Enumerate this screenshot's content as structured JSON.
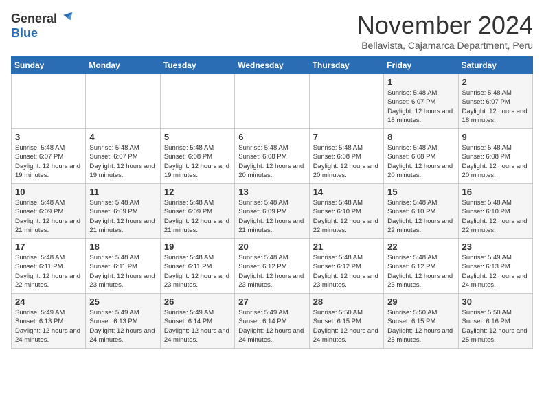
{
  "header": {
    "logo_general": "General",
    "logo_blue": "Blue",
    "month_title": "November 2024",
    "location": "Bellavista, Cajamarca Department, Peru"
  },
  "days_of_week": [
    "Sunday",
    "Monday",
    "Tuesday",
    "Wednesday",
    "Thursday",
    "Friday",
    "Saturday"
  ],
  "weeks": [
    [
      {
        "day": "",
        "info": ""
      },
      {
        "day": "",
        "info": ""
      },
      {
        "day": "",
        "info": ""
      },
      {
        "day": "",
        "info": ""
      },
      {
        "day": "",
        "info": ""
      },
      {
        "day": "1",
        "info": "Sunrise: 5:48 AM\nSunset: 6:07 PM\nDaylight: 12 hours and 18 minutes."
      },
      {
        "day": "2",
        "info": "Sunrise: 5:48 AM\nSunset: 6:07 PM\nDaylight: 12 hours and 18 minutes."
      }
    ],
    [
      {
        "day": "3",
        "info": "Sunrise: 5:48 AM\nSunset: 6:07 PM\nDaylight: 12 hours and 19 minutes."
      },
      {
        "day": "4",
        "info": "Sunrise: 5:48 AM\nSunset: 6:07 PM\nDaylight: 12 hours and 19 minutes."
      },
      {
        "day": "5",
        "info": "Sunrise: 5:48 AM\nSunset: 6:08 PM\nDaylight: 12 hours and 19 minutes."
      },
      {
        "day": "6",
        "info": "Sunrise: 5:48 AM\nSunset: 6:08 PM\nDaylight: 12 hours and 20 minutes."
      },
      {
        "day": "7",
        "info": "Sunrise: 5:48 AM\nSunset: 6:08 PM\nDaylight: 12 hours and 20 minutes."
      },
      {
        "day": "8",
        "info": "Sunrise: 5:48 AM\nSunset: 6:08 PM\nDaylight: 12 hours and 20 minutes."
      },
      {
        "day": "9",
        "info": "Sunrise: 5:48 AM\nSunset: 6:08 PM\nDaylight: 12 hours and 20 minutes."
      }
    ],
    [
      {
        "day": "10",
        "info": "Sunrise: 5:48 AM\nSunset: 6:09 PM\nDaylight: 12 hours and 21 minutes."
      },
      {
        "day": "11",
        "info": "Sunrise: 5:48 AM\nSunset: 6:09 PM\nDaylight: 12 hours and 21 minutes."
      },
      {
        "day": "12",
        "info": "Sunrise: 5:48 AM\nSunset: 6:09 PM\nDaylight: 12 hours and 21 minutes."
      },
      {
        "day": "13",
        "info": "Sunrise: 5:48 AM\nSunset: 6:09 PM\nDaylight: 12 hours and 21 minutes."
      },
      {
        "day": "14",
        "info": "Sunrise: 5:48 AM\nSunset: 6:10 PM\nDaylight: 12 hours and 22 minutes."
      },
      {
        "day": "15",
        "info": "Sunrise: 5:48 AM\nSunset: 6:10 PM\nDaylight: 12 hours and 22 minutes."
      },
      {
        "day": "16",
        "info": "Sunrise: 5:48 AM\nSunset: 6:10 PM\nDaylight: 12 hours and 22 minutes."
      }
    ],
    [
      {
        "day": "17",
        "info": "Sunrise: 5:48 AM\nSunset: 6:11 PM\nDaylight: 12 hours and 22 minutes."
      },
      {
        "day": "18",
        "info": "Sunrise: 5:48 AM\nSunset: 6:11 PM\nDaylight: 12 hours and 23 minutes."
      },
      {
        "day": "19",
        "info": "Sunrise: 5:48 AM\nSunset: 6:11 PM\nDaylight: 12 hours and 23 minutes."
      },
      {
        "day": "20",
        "info": "Sunrise: 5:48 AM\nSunset: 6:12 PM\nDaylight: 12 hours and 23 minutes."
      },
      {
        "day": "21",
        "info": "Sunrise: 5:48 AM\nSunset: 6:12 PM\nDaylight: 12 hours and 23 minutes."
      },
      {
        "day": "22",
        "info": "Sunrise: 5:48 AM\nSunset: 6:12 PM\nDaylight: 12 hours and 23 minutes."
      },
      {
        "day": "23",
        "info": "Sunrise: 5:49 AM\nSunset: 6:13 PM\nDaylight: 12 hours and 24 minutes."
      }
    ],
    [
      {
        "day": "24",
        "info": "Sunrise: 5:49 AM\nSunset: 6:13 PM\nDaylight: 12 hours and 24 minutes."
      },
      {
        "day": "25",
        "info": "Sunrise: 5:49 AM\nSunset: 6:13 PM\nDaylight: 12 hours and 24 minutes."
      },
      {
        "day": "26",
        "info": "Sunrise: 5:49 AM\nSunset: 6:14 PM\nDaylight: 12 hours and 24 minutes."
      },
      {
        "day": "27",
        "info": "Sunrise: 5:49 AM\nSunset: 6:14 PM\nDaylight: 12 hours and 24 minutes."
      },
      {
        "day": "28",
        "info": "Sunrise: 5:50 AM\nSunset: 6:15 PM\nDaylight: 12 hours and 24 minutes."
      },
      {
        "day": "29",
        "info": "Sunrise: 5:50 AM\nSunset: 6:15 PM\nDaylight: 12 hours and 25 minutes."
      },
      {
        "day": "30",
        "info": "Sunrise: 5:50 AM\nSunset: 6:16 PM\nDaylight: 12 hours and 25 minutes."
      }
    ]
  ]
}
